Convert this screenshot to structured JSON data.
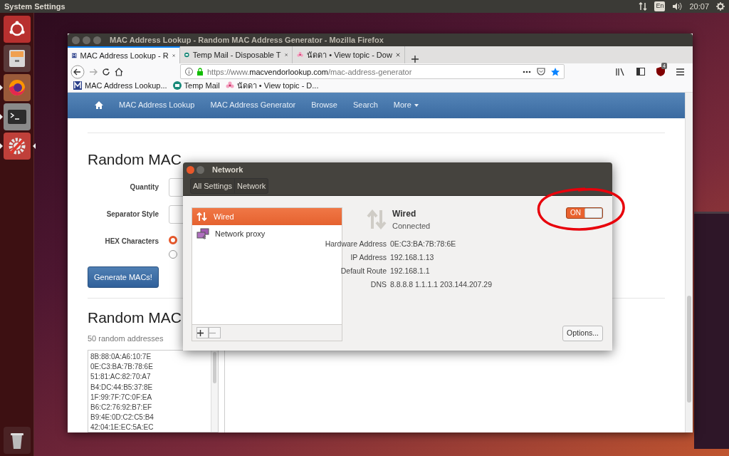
{
  "top_panel": {
    "title": "System Settings",
    "keyboard": "En",
    "clock": "20:07"
  },
  "launcher": {
    "items": [
      {
        "kind": "ubuntu",
        "running": false,
        "focused": false
      },
      {
        "kind": "files",
        "running": false,
        "focused": false
      },
      {
        "kind": "firefox",
        "running": true,
        "focused": false
      },
      {
        "kind": "terminal",
        "running": true,
        "focused": false
      },
      {
        "kind": "settings",
        "running": true,
        "focused": true
      }
    ],
    "trash": {
      "kind": "trash"
    }
  },
  "browser": {
    "title": "MAC Address Lookup - Random MAC Address Generator - Mozilla Firefox",
    "tabs": [
      {
        "label": "MAC Address Lookup - R",
        "selected": true,
        "kind": "m"
      },
      {
        "label": "Temp Mail - Disposable T",
        "selected": false,
        "kind": "mail"
      },
      {
        "label": "นัดดา • View topic - Dow",
        "selected": false,
        "kind": "flower"
      }
    ],
    "url": {
      "prefix": "https://www.",
      "domain": "macvendorlookup.com",
      "path": "/mac-address-generator"
    },
    "addon_badge": "4",
    "bookmarks": [
      {
        "label": "MAC Address Lookup...",
        "kind": "m"
      },
      {
        "label": "Temp Mail",
        "kind": "mail"
      },
      {
        "label": "นัดดา • View topic - D...",
        "kind": "flower"
      }
    ],
    "site_nav": [
      {
        "label": "MAC Address Lookup",
        "dropdown": false
      },
      {
        "label": "MAC Address Generator",
        "dropdown": false
      },
      {
        "label": "Browse",
        "dropdown": false
      },
      {
        "label": "Search",
        "dropdown": false
      },
      {
        "label": "More",
        "dropdown": true
      }
    ],
    "page": {
      "heading": "Random MAC",
      "form": [
        {
          "label": "Quantity"
        },
        {
          "label": "Separator Style"
        },
        {
          "label": "HEX Characters"
        }
      ],
      "radios": [
        {
          "selected": true
        },
        {
          "selected": false
        }
      ],
      "button": "Generate MACs!",
      "results_heading": "Random MAC",
      "results_note": "50 random addresses",
      "addresses": [
        "8B:88:0A:A6:10:7E",
        "0E:C3:BA:7B:78:6E",
        "51:81:AC:82:70:A7",
        "B4:DC:44:B5:37:8E",
        "1F:99:7F:7C:0F:EA",
        "B6:C2:76:92:B7:EF",
        "B9:4E:0D:C2:C5:B4",
        "42:04:1E:EC:5A:EC"
      ]
    }
  },
  "dialog": {
    "title": "Network",
    "breadcrumbs": [
      "All Settings",
      "Network"
    ],
    "devices": [
      {
        "label": "Wired",
        "selected": true,
        "kind": "wired"
      },
      {
        "label": "Network proxy",
        "selected": false,
        "kind": "proxy"
      }
    ],
    "detail": {
      "name": "Wired",
      "status": "Connected",
      "switch": {
        "on": true,
        "label": "ON",
        "circled": true
      },
      "fields": [
        {
          "label": "Hardware Address",
          "value": "0E:C3:BA:7B:78:6E"
        },
        {
          "label": "IP Address",
          "value": "192.168.1.13"
        },
        {
          "label": "Default Route",
          "value": "192.168.1.1"
        },
        {
          "label": "DNS",
          "value": "8.8.8.8 1.1.1.1 203.144.207.29"
        }
      ]
    },
    "options_button": "Options..."
  }
}
